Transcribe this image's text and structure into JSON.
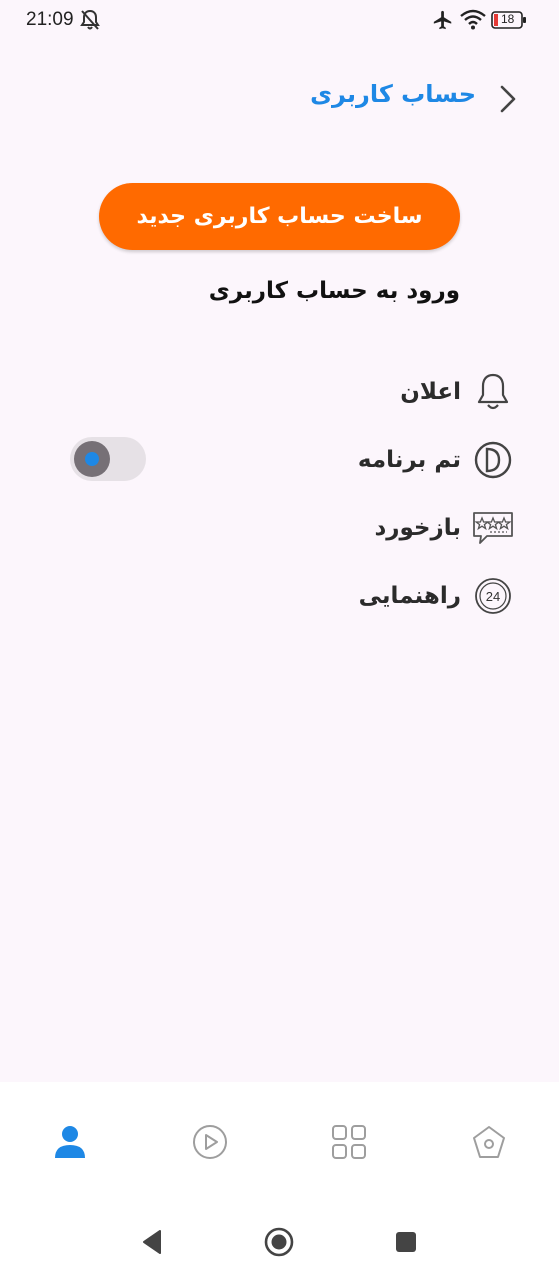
{
  "status_bar": {
    "time": "21:09",
    "battery_level": "18",
    "icons": [
      "notifications-off-icon",
      "airplane-icon",
      "wifi-icon",
      "battery-icon"
    ]
  },
  "header": {
    "title": "حساب کاربری",
    "back_icon": "chevron-right-icon"
  },
  "account": {
    "create_account_label": "ساخت حساب کاربری جدید",
    "login_label": "ورود به حساب کاربری"
  },
  "settings": {
    "items": [
      {
        "label": "اعلان",
        "icon": "bell-icon"
      },
      {
        "label": "تم برنامه",
        "icon": "theme-icon"
      },
      {
        "label": "بازخورد",
        "icon": "feedback-icon"
      },
      {
        "label": "راهنمایی",
        "icon": "support-24-icon"
      }
    ],
    "help_icon_text": "24",
    "theme_toggle_on": false
  },
  "bottom_nav": {
    "items": [
      {
        "id": "profile",
        "icon": "person-icon",
        "active": true
      },
      {
        "id": "video",
        "icon": "play-circle-icon",
        "active": false
      },
      {
        "id": "categories",
        "icon": "grid-icon",
        "active": false
      },
      {
        "id": "home",
        "icon": "home-icon",
        "active": false
      }
    ]
  },
  "colors": {
    "accent": "#1e88e5",
    "primary_button": "#ff6a00",
    "background": "#fcf6fc",
    "icon_gray": "#9e9e9e"
  }
}
